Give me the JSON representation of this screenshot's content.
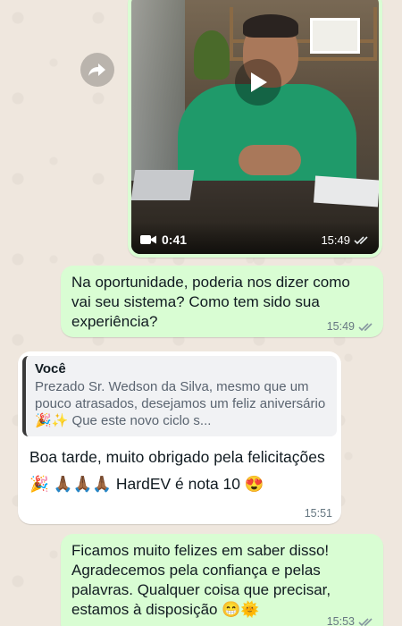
{
  "video_message": {
    "duration": "0:41",
    "time": "15:49",
    "status_icon": "double-check-icon"
  },
  "messages": [
    {
      "direction": "outgoing",
      "text": "Na oportunidade, poderia nos dizer como vai seu sistema? Como tem sido sua experiência?",
      "time": "15:49",
      "status_icon": "double-check-icon"
    },
    {
      "direction": "incoming",
      "quote": {
        "author": "Você",
        "text": "Prezado Sr. Wedson da Silva, mesmo que um pouco atrasados, desejamos um feliz aniversário 🎉✨ Que este novo ciclo s..."
      },
      "text": "Boa tarde, muito obrigado pela felicitações 🎉 🙏🏾🙏🏾🙏🏾 HardEV é nota 10 😍",
      "time": "15:51"
    },
    {
      "direction": "outgoing",
      "text": "Ficamos muito felizes em saber disso! Agradecemos pela confiança e pelas palavras. Qualquer coisa que precisar, estamos à disposição 😁🌞",
      "time": "15:53",
      "status_icon": "double-check-icon"
    }
  ],
  "colors": {
    "outgoing_bubble": "#d9fdd3",
    "incoming_bubble": "#ffffff",
    "wallpaper": "#efe7de",
    "read_check": "#8696a0"
  }
}
